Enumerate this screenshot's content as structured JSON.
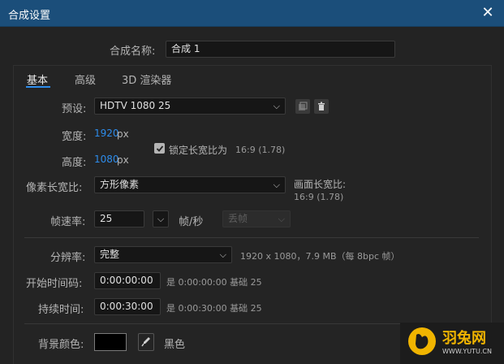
{
  "window": {
    "title": "合成设置"
  },
  "comp_name": {
    "label": "合成名称:",
    "value": "合成 1"
  },
  "tabs": [
    {
      "label": "基本",
      "active": true
    },
    {
      "label": "高级",
      "active": false
    },
    {
      "label": "3D 渲染器",
      "active": false
    }
  ],
  "preset": {
    "label": "预设:",
    "value": "HDTV 1080 25"
  },
  "width": {
    "label": "宽度:",
    "value": "1920",
    "unit": "px"
  },
  "height": {
    "label": "高度:",
    "value": "1080",
    "unit": "px"
  },
  "lock_aspect": {
    "label": "锁定长宽比为",
    "ratio": "16:9 (1.78)",
    "checked": true
  },
  "pixel_aspect": {
    "label": "像素长宽比:",
    "value": "方形像素"
  },
  "frame_aspect": {
    "label": "画面长宽比:",
    "value": "16:9 (1.78)"
  },
  "frame_rate": {
    "label": "帧速率:",
    "value": "25",
    "unit": "帧/秒",
    "drop_frame": "丢帧"
  },
  "resolution": {
    "label": "分辨率:",
    "value": "完整",
    "info": "1920 x 1080，7.9 MB（每 8bpc 帧）"
  },
  "start_timecode": {
    "label": "开始时间码:",
    "value": "0:00:00:00",
    "info": "是 0:00:00:00  基础 25"
  },
  "duration": {
    "label": "持续时间:",
    "value": "0:00:30:00",
    "info": "是 0:00:30:00  基础 25"
  },
  "background": {
    "label": "背景颜色:",
    "color_name": "黑色",
    "color": "#000000"
  },
  "watermark": {
    "name": "羽兔网",
    "url": "WWW.YUTU.CN"
  },
  "colors": {
    "title_bar": "#1b4e7a",
    "accent": "#2d8ceb",
    "background": "#232323"
  }
}
